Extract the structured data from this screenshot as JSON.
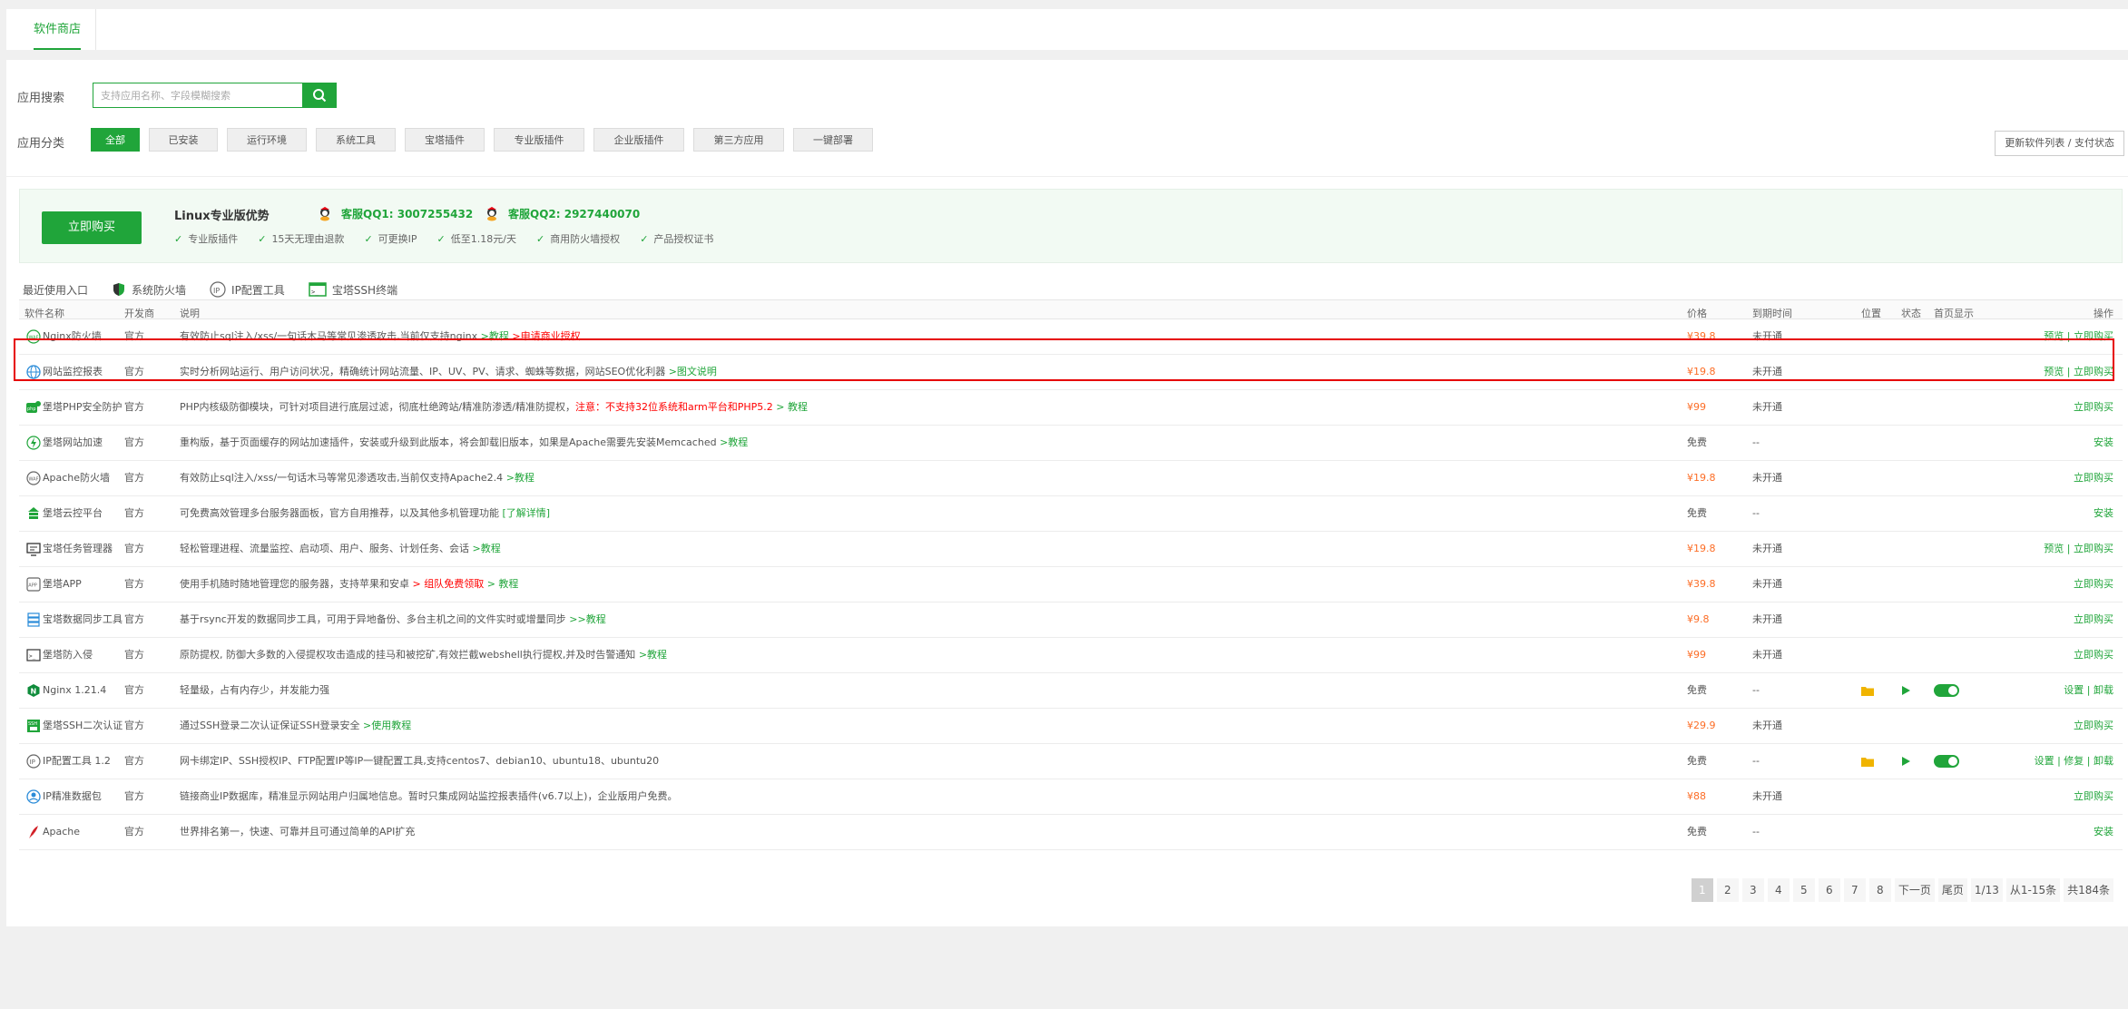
{
  "top_tab": "软件商店",
  "search": {
    "label": "应用搜索",
    "placeholder": "支持应用名称、字段模糊搜索"
  },
  "category": {
    "label": "应用分类",
    "items": [
      "全部",
      "已安装",
      "运行环境",
      "系统工具",
      "宝塔插件",
      "专业版插件",
      "企业版插件",
      "第三方应用",
      "一键部署"
    ],
    "active": "全部"
  },
  "update_button": "更新软件列表 / 支付状态",
  "promo": {
    "buy_button": "立即购买",
    "title": "Linux专业版优势",
    "qq1": "客服QQ1: 3007255432",
    "qq2": "客服QQ2: 2927440070",
    "features": [
      "专业版插件",
      "15天无理由退款",
      "可更换IP",
      "低至1.18元/天",
      "商用防火墙授权",
      "产品授权证书"
    ]
  },
  "recent": {
    "label": "最近使用入口",
    "items": [
      "系统防火墙",
      "IP配置工具",
      "宝塔SSH终端"
    ]
  },
  "table": {
    "headers": {
      "name": "软件名称",
      "dev": "开发商",
      "desc": "说明",
      "price": "价格",
      "expire": "到期时间",
      "pos": "位置",
      "status": "状态",
      "home": "首页显示",
      "ops": "操作"
    },
    "rows": [
      {
        "name": "Nginx防火墙",
        "dev": "官方",
        "desc": "有效防止sql注入/xss/一句话木马等常见渗透攻击,当前仅支持nginx",
        "link1": ">教程",
        "link2": ">申请商业授权",
        "price": "¥39.8",
        "expire": "未开通",
        "ops": "预览 | 立即购买"
      },
      {
        "name": "网站监控报表",
        "dev": "官方",
        "desc": "实时分析网站运行、用户访问状况，精确统计网站流量、IP、UV、PV、请求、蜘蛛等数据，网站SEO优化利器",
        "link1": ">图文说明",
        "price": "¥19.8",
        "expire": "未开通",
        "ops": "预览 | 立即购买"
      },
      {
        "name": "堡塔PHP安全防护",
        "dev": "官方",
        "desc": "PHP内核级防御模块，可针对项目进行底层过滤，彻底杜绝跨站/精准防渗透/精准防提权，",
        "warn": "注意：不支持32位系统和arm平台和PHP5.2",
        "link1": "> 教程",
        "price": "¥99",
        "expire": "未开通",
        "ops": "立即购买"
      },
      {
        "name": "堡塔网站加速",
        "dev": "官方",
        "desc": "重构版，基于页面缓存的网站加速插件，安装或升级到此版本，将会卸载旧版本，如果是Apache需要先安装Memcached",
        "link1": ">教程",
        "price": "免费",
        "expire": "--",
        "ops": "安装"
      },
      {
        "name": "Apache防火墙",
        "dev": "官方",
        "desc": "有效防止sql注入/xss/一句话木马等常见渗透攻击,当前仅支持Apache2.4",
        "link1": ">教程",
        "price": "¥19.8",
        "expire": "未开通",
        "ops": "立即购买"
      },
      {
        "name": "堡塔云控平台",
        "dev": "官方",
        "desc": "可免费高效管理多台服务器面板，官方自用推荐，以及其他多机管理功能",
        "link1": "[了解详情]",
        "price": "免费",
        "expire": "--",
        "ops": "安装"
      },
      {
        "name": "宝塔任务管理器",
        "dev": "官方",
        "desc": "轻松管理进程、流量监控、启动项、用户、服务、计划任务、会话",
        "link1": ">教程",
        "price": "¥19.8",
        "expire": "未开通",
        "ops": "预览 | 立即购买"
      },
      {
        "name": "堡塔APP",
        "dev": "官方",
        "desc": "使用手机随时随地管理您的服务器，支持苹果和安卓",
        "warn": "> 组队免费领取",
        "link1": "> 教程",
        "price": "¥39.8",
        "expire": "未开通",
        "ops": "立即购买"
      },
      {
        "name": "宝塔数据同步工具",
        "dev": "官方",
        "desc": "基于rsync开发的数据同步工具，可用于异地备份、多台主机之间的文件实时或增量同步",
        "link1": ">>教程",
        "price": "¥9.8",
        "expire": "未开通",
        "ops": "立即购买"
      },
      {
        "name": "堡塔防入侵",
        "dev": "官方",
        "desc": "原防提权, 防御大多数的入侵提权攻击造成的挂马和被挖矿,有效拦截webshell执行提权,并及时告警通知",
        "link1": ">教程",
        "price": "¥99",
        "expire": "未开通",
        "ops": "立即购买"
      },
      {
        "name": "Nginx 1.21.4",
        "dev": "官方",
        "desc": "轻量级，占有内存少，并发能力强",
        "price": "免费",
        "expire": "--",
        "installed": true,
        "ops": "设置 | 卸载"
      },
      {
        "name": "堡塔SSH二次认证",
        "dev": "官方",
        "desc": "通过SSH登录二次认证保证SSH登录安全",
        "link1": ">使用教程",
        "price": "¥29.9",
        "expire": "未开通",
        "ops": "立即购买"
      },
      {
        "name": "IP配置工具 1.2",
        "dev": "官方",
        "desc": "网卡绑定IP、SSH授权IP、FTP配置IP等IP一键配置工具,支持centos7、debian10、ubuntu18、ubuntu20",
        "price": "免费",
        "expire": "--",
        "installed": true,
        "ops": "设置 | 修复 | 卸载"
      },
      {
        "name": "IP精准数据包",
        "dev": "官方",
        "desc": "链接商业IP数据库，精准显示网站用户归属地信息。暂时只集成网站监控报表插件(v6.7以上)，企业版用户免费。",
        "price": "¥88",
        "expire": "未开通",
        "ops": "立即购买"
      },
      {
        "name": "Apache",
        "dev": "官方",
        "desc": "世界排名第一，快速、可靠并且可通过简单的API扩充",
        "price": "免费",
        "expire": "--",
        "ops": "安装"
      }
    ]
  },
  "pager": {
    "pages": [
      "1",
      "2",
      "3",
      "4",
      "5",
      "6",
      "7",
      "8"
    ],
    "next": "下一页",
    "last": "尾页",
    "page_info": "1/13",
    "range": "从1-15条",
    "total": "共184条"
  },
  "colors": {
    "accent": "#20a53a",
    "price": "#fc6d26",
    "highlight_border": "#e60000"
  }
}
